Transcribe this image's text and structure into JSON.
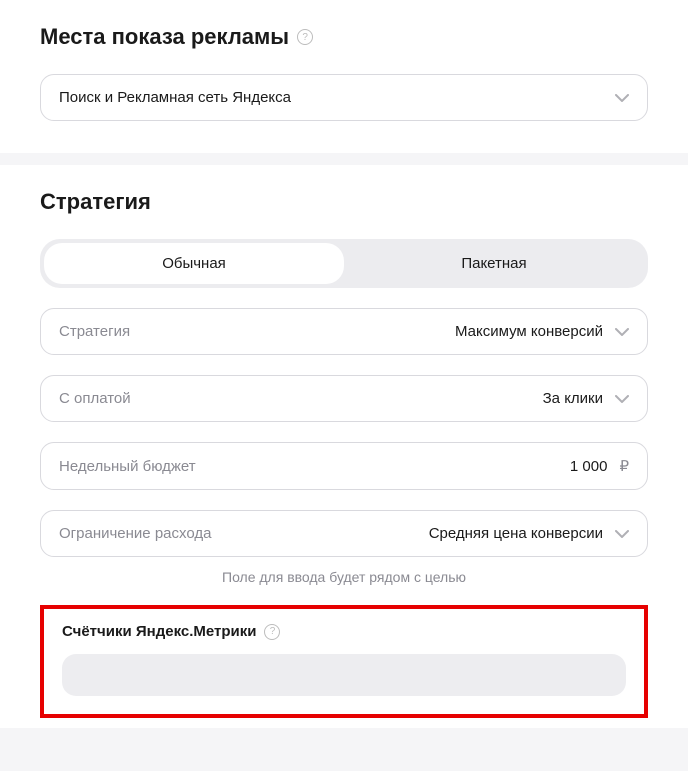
{
  "ad_places": {
    "title": "Места показа рекламы",
    "value": "Поиск и Рекламная сеть Яндекса"
  },
  "strategy": {
    "title": "Стратегия",
    "tabs": {
      "normal": "Обычная",
      "packet": "Пакетная"
    },
    "fields": {
      "strategy_label": "Стратегия",
      "strategy_value": "Максимум конверсий",
      "payment_label": "С оплатой",
      "payment_value": "За клики",
      "budget_label": "Недельный бюджет",
      "budget_value": "1 000",
      "budget_currency": "₽",
      "spend_limit_label": "Ограничение расхода",
      "spend_limit_value": "Средняя цена конверсии"
    },
    "hint": "Поле для ввода будет рядом с целью"
  },
  "metrika": {
    "title": "Счётчики Яндекс.Метрики"
  }
}
